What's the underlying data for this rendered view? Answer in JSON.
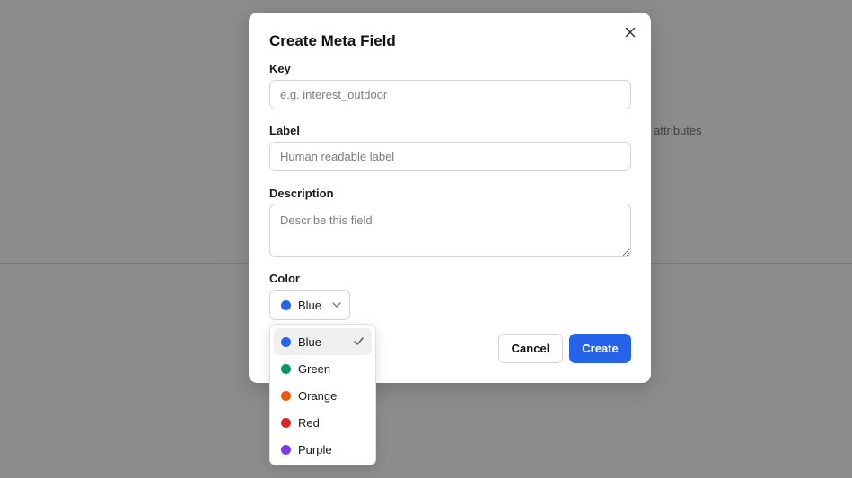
{
  "background": {
    "partial_text": "or attributes"
  },
  "dialog": {
    "title": "Create Meta Field",
    "close_icon": "close-icon",
    "fields": {
      "key": {
        "label": "Key",
        "placeholder": "e.g. interest_outdoor",
        "value": ""
      },
      "label": {
        "label": "Label",
        "placeholder": "Human readable label",
        "value": ""
      },
      "description": {
        "label": "Description",
        "placeholder": "Describe this field",
        "value": ""
      },
      "color": {
        "label": "Color",
        "selected": "Blue",
        "selected_color": "#2563eb"
      }
    },
    "buttons": {
      "cancel": "Cancel",
      "create": "Create"
    }
  },
  "color_menu": {
    "options": [
      {
        "label": "Blue",
        "color": "#2563eb",
        "selected": true
      },
      {
        "label": "Green",
        "color": "#059669",
        "selected": false
      },
      {
        "label": "Orange",
        "color": "#ea580c",
        "selected": false
      },
      {
        "label": "Red",
        "color": "#dc2626",
        "selected": false
      },
      {
        "label": "Purple",
        "color": "#7c3aed",
        "selected": false
      }
    ]
  },
  "colors": {
    "accent": "#2563eb",
    "overlay": "#8c8c8c"
  }
}
